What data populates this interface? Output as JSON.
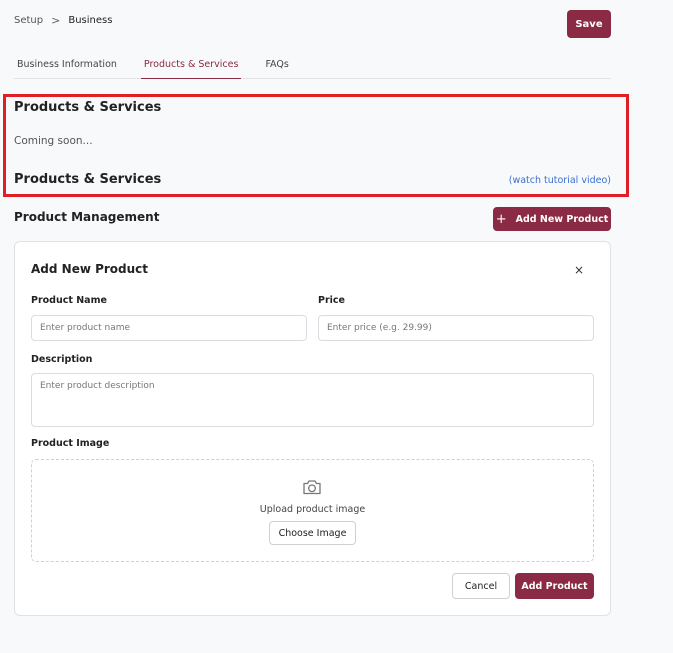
{
  "breadcrumb": {
    "parent": "Setup",
    "separator": ">",
    "current": "Business"
  },
  "header": {
    "save_label": "Save"
  },
  "tabs": [
    {
      "label": "Business Information",
      "active": false
    },
    {
      "label": "Products & Services",
      "active": true
    },
    {
      "label": "FAQs",
      "active": false
    }
  ],
  "section": {
    "title": "Products & Services",
    "coming_soon": "Coming soon...",
    "subtitle": "Products & Services",
    "tutorial_link": "(watch tutorial video)"
  },
  "management": {
    "title": "Product Management",
    "add_button_icon": "+",
    "add_button_label": "Add New Product"
  },
  "form": {
    "title": "Add New Product",
    "close_icon": "×",
    "product_name_label": "Product Name",
    "product_name_placeholder": "Enter product name",
    "product_name_value": "",
    "price_label": "Price",
    "price_placeholder": "Enter price (e.g. 29.99)",
    "price_value": "",
    "description_label": "Description",
    "description_placeholder": "Enter product description",
    "image_label": "Product Image",
    "upload_text": "Upload product image",
    "choose_image_label": "Choose Image",
    "cancel_label": "Cancel",
    "submit_label": "Add Product"
  },
  "colors": {
    "brand": "#8a2a45",
    "highlight": "#e01e26",
    "link": "#3b6fd1"
  },
  "icons": {
    "breadcrumb_separator": "chevron-right-icon",
    "add": "plus-icon",
    "close": "close-icon",
    "upload": "camera-icon"
  }
}
